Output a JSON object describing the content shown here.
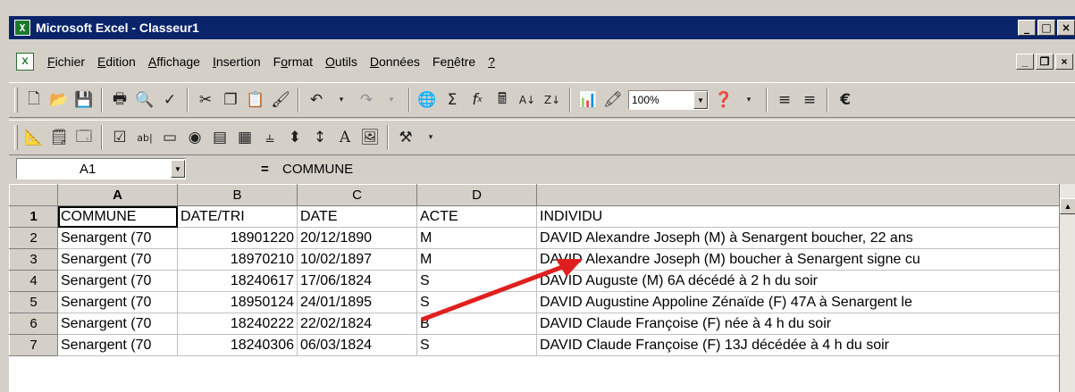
{
  "window": {
    "title": "Microsoft Excel - Classeur1",
    "app_icon": "excel-icon"
  },
  "window_buttons": [
    "_",
    "□",
    "×"
  ],
  "menu": {
    "items": [
      {
        "pre": "",
        "u": "F",
        "post": "ichier"
      },
      {
        "pre": "",
        "u": "E",
        "post": "dition"
      },
      {
        "pre": "",
        "u": "A",
        "post": "ffichage"
      },
      {
        "pre": "",
        "u": "I",
        "post": "nsertion"
      },
      {
        "pre": "F",
        "u": "o",
        "post": "rmat"
      },
      {
        "pre": "",
        "u": "O",
        "post": "utils"
      },
      {
        "pre": "",
        "u": "D",
        "post": "onnées"
      },
      {
        "pre": "Fe",
        "u": "n",
        "post": "être"
      },
      {
        "pre": "",
        "u": "?",
        "post": ""
      }
    ]
  },
  "toolbar": {
    "zoom": "100%",
    "currency": "€"
  },
  "formula_bar": {
    "cell_ref": "A1",
    "equals": "=",
    "content": "COMMUNE"
  },
  "sheet": {
    "columns": [
      "A",
      "B",
      "C",
      "D",
      ""
    ],
    "rows": [
      {
        "n": "1",
        "cells": [
          "COMMUNE",
          "DATE/TRI",
          "DATE",
          "ACTE",
          "INDIVIDU"
        ]
      },
      {
        "n": "2",
        "cells": [
          "Senargent (70",
          "18901220",
          "20/12/1890",
          "M",
          "DAVID Alexandre Joseph (M) à Senargent boucher, 22 ans"
        ]
      },
      {
        "n": "3",
        "cells": [
          "Senargent (70",
          "18970210",
          "10/02/1897",
          "M",
          "DAVID Alexandre Joseph (M) boucher à Senargent signe cu"
        ]
      },
      {
        "n": "4",
        "cells": [
          "Senargent (70",
          "18240617",
          "17/06/1824",
          "S",
          "DAVID Auguste (M) 6A décédé à 2 h du soir"
        ]
      },
      {
        "n": "5",
        "cells": [
          "Senargent (70",
          "18950124",
          "24/01/1895",
          "S",
          "DAVID Augustine Appoline Zénaïde (F) 47A à Senargent le"
        ]
      },
      {
        "n": "6",
        "cells": [
          "Senargent (70",
          "18240222",
          "22/02/1824",
          "B",
          "DAVID Claude Françoise (F) née à 4 h du soir"
        ]
      },
      {
        "n": "7",
        "cells": [
          "Senargent (70",
          "18240306",
          "06/03/1824",
          "S",
          "DAVID Claude Françoise (F) 13J décédée à 4 h du soir"
        ]
      }
    ]
  },
  "annotation_color": "#e02020"
}
